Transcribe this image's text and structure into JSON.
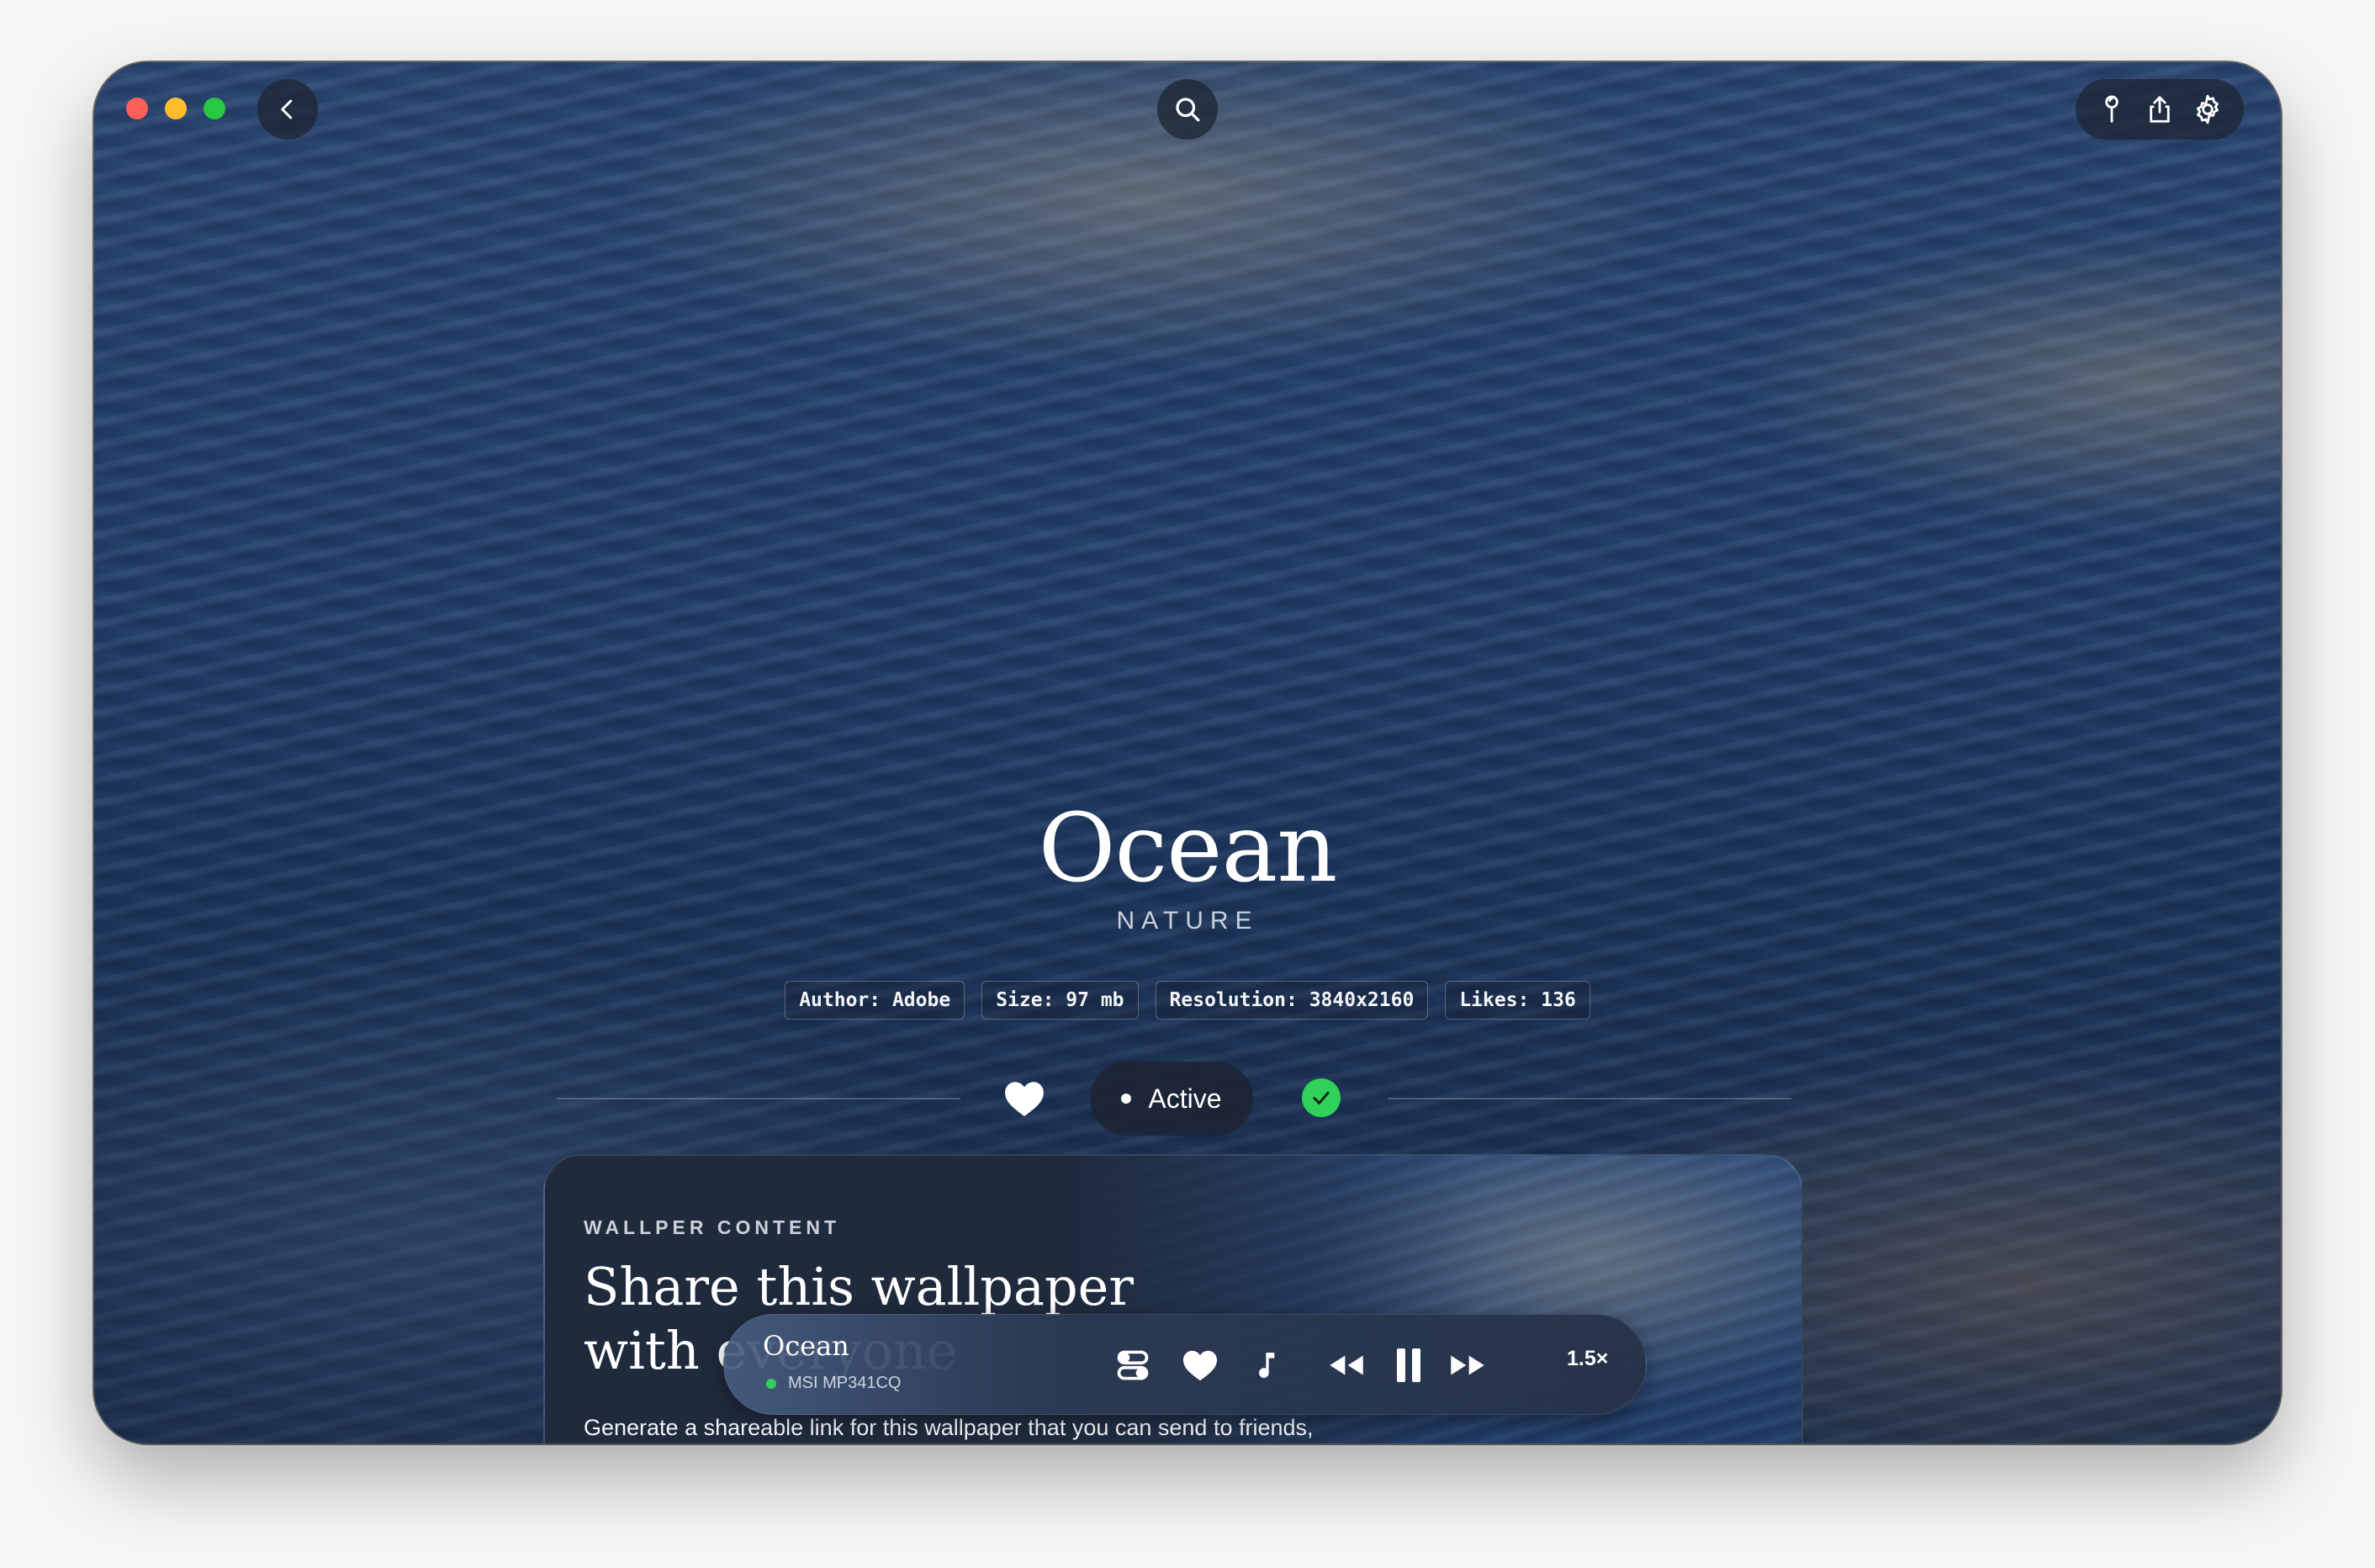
{
  "wallpaper": {
    "title": "Ocean",
    "category": "NATURE",
    "meta": [
      "Author: Adobe",
      "Size: 97 mb",
      "Resolution: 3840x2160",
      "Likes: 136"
    ],
    "status_label": "Active"
  },
  "card": {
    "eyebrow": "WALLPER CONTENT",
    "heading": "Share this wallpaper with everyone",
    "description": "Generate a shareable link for this wallpaper that you can send to friends,"
  },
  "player": {
    "title": "Ocean",
    "device": "MSI MP341CQ",
    "speed": "1.5×"
  },
  "colors": {
    "accent_green": "#2fd158",
    "traffic_red": "#fe5f57",
    "traffic_yellow": "#febc2e",
    "traffic_green": "#28c840"
  },
  "icons": {
    "toolbar": [
      "back-chevron-icon",
      "search-icon",
      "pin-icon",
      "share-icon",
      "gear-icon"
    ],
    "player": [
      "toggle-icon",
      "heart-icon",
      "music-note-icon",
      "rewind-icon",
      "pause-icon",
      "fast-forward-icon"
    ]
  }
}
